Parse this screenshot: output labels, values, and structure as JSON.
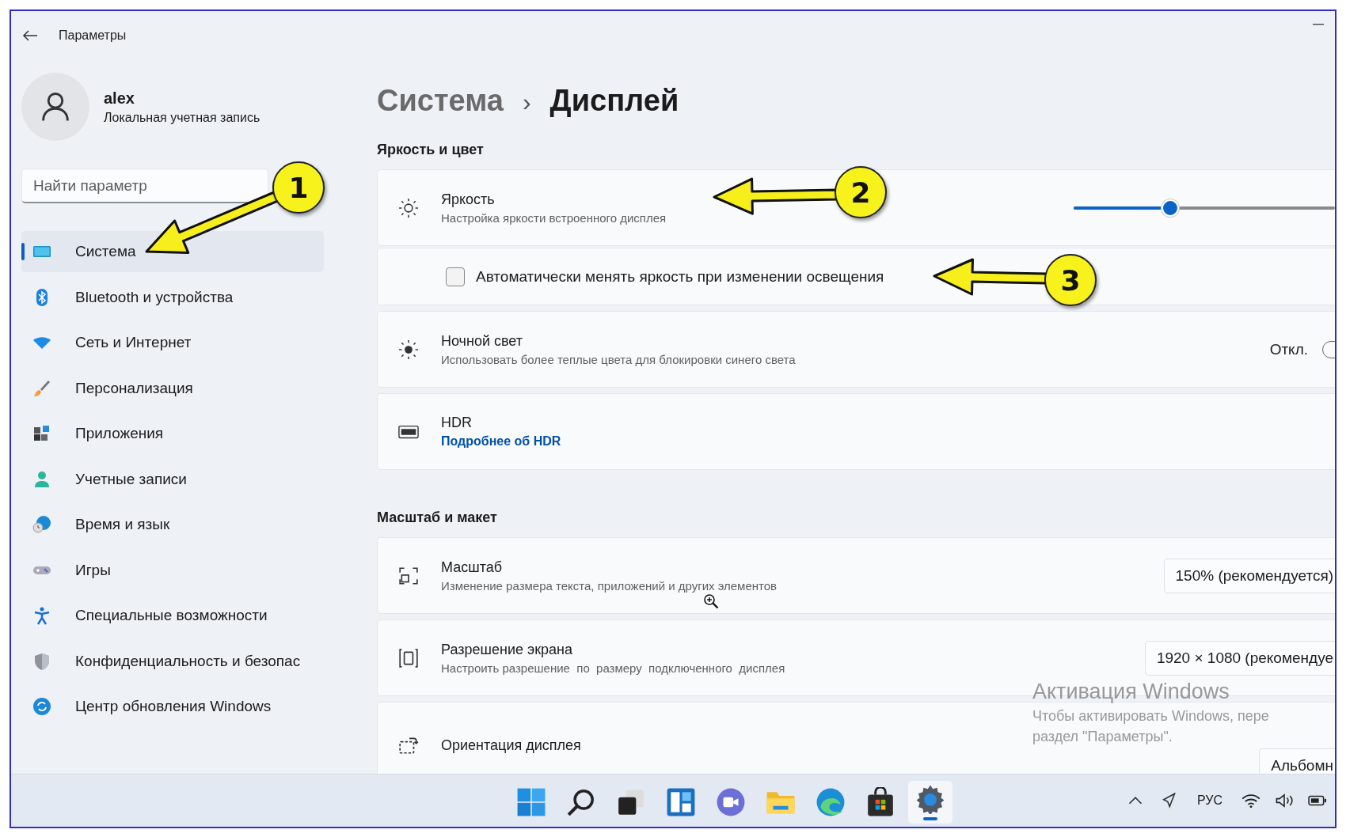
{
  "window": {
    "title": "Параметры"
  },
  "account": {
    "name": "alex",
    "type": "Локальная учетная запись"
  },
  "search": {
    "placeholder": "Найти параметр"
  },
  "sidebar": {
    "items": [
      {
        "label": "Система",
        "selected": true
      },
      {
        "label": "Bluetooth и устройства",
        "selected": false
      },
      {
        "label": "Сеть и Интернет",
        "selected": false
      },
      {
        "label": "Персонализация",
        "selected": false
      },
      {
        "label": "Приложения",
        "selected": false
      },
      {
        "label": "Учетные записи",
        "selected": false
      },
      {
        "label": "Время и язык",
        "selected": false
      },
      {
        "label": "Игры",
        "selected": false
      },
      {
        "label": "Специальные возможности",
        "selected": false
      },
      {
        "label": "Конфиденциальность и безопас",
        "selected": false
      },
      {
        "label": "Центр обновления Windows",
        "selected": false
      }
    ]
  },
  "breadcrumb": {
    "parent": "Система",
    "separator": "›",
    "current": "Дисплей"
  },
  "sections": [
    {
      "title": "Яркость и цвет",
      "cards": [
        {
          "kind": "slider",
          "title": "Яркость",
          "subtitle": "Настройка яркости встроенного дисплея",
          "level": 0.37
        },
        {
          "kind": "checkbox",
          "label": "Автоматически менять яркость при изменении освещения",
          "checked": false
        },
        {
          "kind": "toggle",
          "title": "Ночной свет",
          "subtitle": "Использовать более теплые цвета для блокировки синего света",
          "status": "Откл.",
          "on": false
        },
        {
          "kind": "link",
          "title": "HDR",
          "link": "Подробнее об HDR"
        }
      ]
    },
    {
      "title": "Масштаб и макет",
      "cards": [
        {
          "kind": "dropdown",
          "title": "Масштаб",
          "subtitle": "Изменение размера текста, приложений и других элементов",
          "value": "150% (рекомендуется)"
        },
        {
          "kind": "dropdown",
          "title": "Разрешение экрана",
          "subtitle": "Настроить разрешение  по  размеру  подключенного  дисплея",
          "value": "1920 × 1080 (рекомендуе"
        },
        {
          "kind": "dropdown",
          "title": "Ориентация дисплея",
          "value": "Альбомн"
        }
      ]
    }
  ],
  "activation": {
    "title": "Активация Windows",
    "lines": [
      "Чтобы активировать Windows, пере",
      "раздел \"Параметры\"."
    ]
  },
  "taskbar": {
    "language": "РУС"
  },
  "callouts": [
    {
      "number": "1"
    },
    {
      "number": "2"
    },
    {
      "number": "3"
    }
  ]
}
